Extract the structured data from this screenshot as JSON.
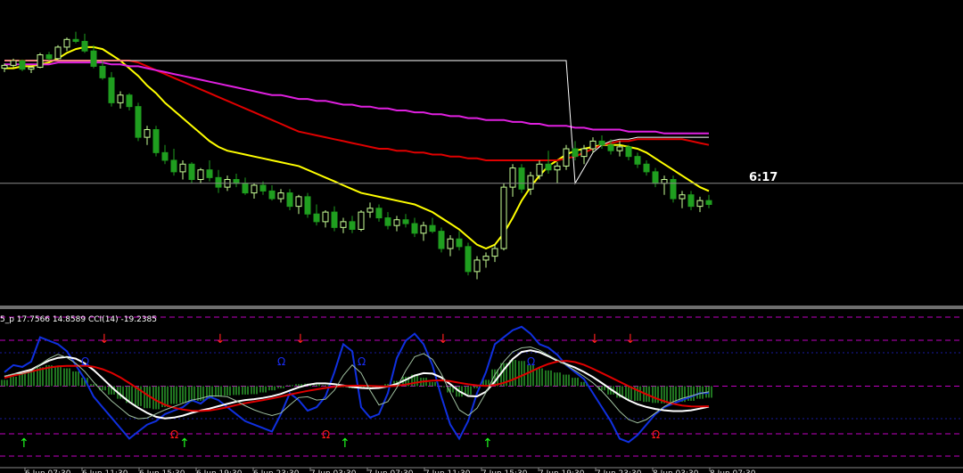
{
  "timer_label": "6:17",
  "indicator_label": "5_p 17.7566 14.8589  CCI(14) -19.2385",
  "time_axis_labels": [
    "6 Jun 07:30",
    "6 Jun 11:30",
    "6 Jun 15:30",
    "6 Jun 19:30",
    "6 Jun 23:30",
    "7 Jun 03:30",
    "7 Jun 07:30",
    "7 Jun 11:30",
    "7 Jun 15:30",
    "7 Jun 19:30",
    "7 Jun 23:30",
    "8 Jun 03:30",
    "8 Jun 07:30"
  ],
  "colors": {
    "background": "#000000",
    "bull_candle": "#c8ff96",
    "bear_candle": "#1f9e1f",
    "fast_ma": "#ffff00",
    "mid_ma": "#e00000",
    "slow_ma": "#e020e0",
    "white_line": "#ffffff",
    "cci_line": "#1030e0",
    "histogram": "#2a9a2a",
    "level_dashed": "#c000c0",
    "level_dotted": "#1a1aa0",
    "arrow_up": "#20ff20",
    "arrow_down": "#ff2020",
    "marker_blue": "#1a2cf0",
    "marker_red": "#ff1a1a"
  },
  "chart_data": [
    {
      "type": "candlestick",
      "title": "",
      "price_line_label": "6:17",
      "candles": [
        [
          100,
          102.5,
          98,
          101.5
        ],
        [
          101.5,
          105,
          100.5,
          104
        ],
        [
          104,
          104.5,
          98.5,
          99.5
        ],
        [
          99.5,
          101,
          97.5,
          100.5
        ],
        [
          100.5,
          108,
          100,
          107
        ],
        [
          107,
          108.5,
          104,
          105
        ],
        [
          105,
          112,
          104.5,
          111
        ],
        [
          111,
          116,
          109,
          115
        ],
        [
          115,
          119,
          113,
          114
        ],
        [
          114,
          118,
          108,
          109
        ],
        [
          109,
          112,
          100,
          101
        ],
        [
          101,
          104,
          94,
          95
        ],
        [
          95,
          98,
          80,
          82
        ],
        [
          82,
          88,
          79,
          86
        ],
        [
          86,
          87,
          78,
          80
        ],
        [
          80,
          82,
          62,
          64
        ],
        [
          64,
          70,
          60,
          68
        ],
        [
          68,
          70,
          54,
          56
        ],
        [
          56,
          60,
          50,
          52
        ],
        [
          52,
          58,
          44,
          46
        ],
        [
          46,
          52,
          42,
          50
        ],
        [
          50,
          51,
          40,
          42
        ],
        [
          42,
          48,
          40,
          47
        ],
        [
          47,
          52,
          41,
          43
        ],
        [
          43,
          47,
          35,
          38
        ],
        [
          38,
          44,
          36,
          42
        ],
        [
          42,
          45,
          38,
          40
        ],
        [
          40,
          43,
          34,
          35
        ],
        [
          35,
          40,
          32,
          39
        ],
        [
          39,
          41,
          34,
          36
        ],
        [
          36,
          39,
          31,
          32
        ],
        [
          32,
          37,
          30,
          35
        ],
        [
          35,
          37,
          26,
          28
        ],
        [
          28,
          34,
          24,
          33
        ],
        [
          33,
          35,
          22,
          24
        ],
        [
          24,
          29,
          18,
          20
        ],
        [
          20,
          26,
          17,
          25
        ],
        [
          25,
          28,
          15,
          17
        ],
        [
          17,
          22,
          14,
          20
        ],
        [
          20,
          23,
          14,
          16
        ],
        [
          16,
          26,
          15,
          25
        ],
        [
          25,
          30,
          22,
          27
        ],
        [
          27,
          29,
          20,
          22
        ],
        [
          22,
          25,
          16,
          18
        ],
        [
          18,
          23,
          15,
          21
        ],
        [
          21,
          24,
          17,
          19
        ],
        [
          19,
          22,
          12,
          14
        ],
        [
          14,
          20,
          10,
          18
        ],
        [
          18,
          22,
          14,
          15
        ],
        [
          15,
          17,
          4,
          6
        ],
        [
          6,
          13,
          2,
          11
        ],
        [
          11,
          15,
          5,
          7
        ],
        [
          7,
          9,
          -8,
          -6
        ],
        [
          -6,
          2,
          -10,
          0
        ],
        [
          0,
          4,
          -4,
          2
        ],
        [
          2,
          8,
          -1,
          6
        ],
        [
          6,
          40,
          5,
          38
        ],
        [
          38,
          50,
          33,
          48
        ],
        [
          48,
          50,
          35,
          37
        ],
        [
          37,
          46,
          34,
          44
        ],
        [
          44,
          52,
          42,
          50
        ],
        [
          50,
          57,
          45,
          47
        ],
        [
          47,
          51,
          40,
          49
        ],
        [
          49,
          60,
          47,
          58
        ],
        [
          58,
          62,
          52,
          54
        ],
        [
          54,
          60,
          50,
          58
        ],
        [
          58,
          64,
          56,
          62
        ],
        [
          62,
          65,
          58,
          60
        ],
        [
          60,
          63,
          55,
          57
        ],
        [
          57,
          62,
          54,
          59
        ],
        [
          59,
          60,
          52,
          54
        ],
        [
          54,
          56,
          48,
          50
        ],
        [
          50,
          52,
          44,
          46
        ],
        [
          46,
          48,
          38,
          40
        ],
        [
          40,
          44,
          34,
          42
        ],
        [
          42,
          44,
          30,
          32
        ],
        [
          32,
          36,
          27,
          34
        ],
        [
          34,
          36,
          26,
          28
        ],
        [
          28,
          33,
          25,
          31
        ],
        [
          31,
          34,
          27,
          29
        ]
      ],
      "overlays": [
        {
          "name": "",
          "color": "#ffff00",
          "values": [
            100,
            100,
            101,
            101,
            102,
            103,
            105,
            108,
            110,
            111,
            111,
            110,
            107,
            104,
            100,
            96,
            91,
            87,
            82,
            78,
            74,
            70,
            66,
            62,
            59,
            57,
            56,
            55,
            54,
            53,
            52,
            51,
            50,
            49,
            47,
            45,
            43,
            41,
            39,
            37,
            35,
            34,
            33,
            32,
            31,
            30,
            29,
            27,
            25,
            22,
            19,
            16,
            12,
            8,
            6,
            8,
            14,
            22,
            31,
            38,
            44,
            49,
            52,
            55,
            57,
            58,
            59,
            60,
            60,
            60,
            59,
            58,
            56,
            53,
            50,
            47,
            44,
            41,
            38,
            36
          ]
        },
        {
          "name": "",
          "color": "#e00000",
          "values": [
            104,
            104,
            104,
            104,
            104,
            104,
            104,
            104,
            104,
            104,
            104,
            104,
            104,
            104,
            104,
            103,
            101,
            99,
            97,
            95,
            93,
            91,
            89,
            87,
            85,
            83,
            81,
            79,
            77,
            75,
            73,
            71,
            69,
            67,
            66,
            65,
            64,
            63,
            62,
            61,
            60,
            59,
            58,
            58,
            57,
            57,
            56,
            56,
            55,
            55,
            54,
            54,
            53,
            53,
            52,
            52,
            52,
            52,
            52,
            52,
            52,
            52,
            52,
            53,
            54,
            56,
            58,
            60,
            61,
            62,
            62,
            63,
            63,
            63,
            63,
            63,
            63,
            62,
            61,
            60
          ]
        },
        {
          "name": "",
          "color": "#e020e0",
          "values": [
            102,
            102,
            102,
            102,
            102,
            102,
            103,
            103,
            103,
            103,
            103,
            103,
            102,
            102,
            101,
            101,
            100,
            99,
            98,
            97,
            96,
            95,
            94,
            93,
            92,
            91,
            90,
            89,
            88,
            87,
            86,
            86,
            85,
            84,
            84,
            83,
            83,
            82,
            81,
            81,
            80,
            80,
            79,
            79,
            78,
            78,
            77,
            77,
            76,
            76,
            75,
            75,
            74,
            74,
            73,
            73,
            73,
            72,
            72,
            71,
            71,
            70,
            70,
            70,
            69,
            69,
            68,
            68,
            68,
            68,
            67,
            67,
            67,
            67,
            66,
            66,
            66,
            66,
            66,
            66
          ]
        },
        {
          "name": "",
          "color": "#ffffff",
          "values": [
            104,
            104,
            104,
            104,
            104,
            104,
            104,
            104,
            104,
            104,
            104,
            104,
            104,
            104,
            104,
            104,
            104,
            104,
            104,
            104,
            104,
            104,
            104,
            104,
            104,
            104,
            104,
            104,
            104,
            104,
            104,
            104,
            104,
            104,
            104,
            104,
            104,
            104,
            104,
            104,
            104,
            104,
            104,
            104,
            104,
            104,
            104,
            104,
            104,
            104,
            104,
            104,
            104,
            104,
            104,
            104,
            104,
            104,
            104,
            104,
            104,
            104,
            104,
            104,
            40,
            48,
            56,
            60,
            62,
            63,
            63,
            64,
            64,
            64,
            64,
            64,
            64,
            64,
            64,
            64
          ]
        }
      ],
      "price_line": 40,
      "ylim": [
        -20,
        130
      ]
    },
    {
      "type": "oscillator",
      "title": "5_p 17.7566 14.8589  CCI(14) -19.2385",
      "histogram": [
        30,
        45,
        60,
        75,
        90,
        100,
        95,
        85,
        70,
        40,
        10,
        -20,
        -40,
        -60,
        -80,
        -95,
        -105,
        -110,
        -100,
        -85,
        -80,
        -75,
        -70,
        -60,
        -50,
        -45,
        -42,
        -40,
        -38,
        -30,
        -20,
        -10,
        5,
        10,
        12,
        8,
        5,
        0,
        -5,
        -10,
        -8,
        -5,
        0,
        10,
        25,
        45,
        55,
        40,
        20,
        -5,
        -30,
        -50,
        -40,
        -10,
        30,
        80,
        110,
        125,
        120,
        100,
        85,
        75,
        65,
        55,
        40,
        20,
        0,
        -20,
        -40,
        -55,
        -65,
        -70,
        -75,
        -80,
        -82,
        -80,
        -75,
        -70,
        -60,
        -55
      ],
      "cci": [
        40,
        60,
        55,
        70,
        140,
        130,
        120,
        100,
        60,
        20,
        -30,
        -60,
        -90,
        -120,
        -150,
        -130,
        -110,
        -100,
        -80,
        -70,
        -60,
        -40,
        -50,
        -30,
        -40,
        -60,
        -80,
        -100,
        -110,
        -120,
        -130,
        -80,
        -20,
        -40,
        -70,
        -60,
        -30,
        40,
        120,
        100,
        -60,
        -90,
        -80,
        -20,
        80,
        130,
        150,
        120,
        60,
        -30,
        -110,
        -150,
        -100,
        -20,
        40,
        120,
        140,
        160,
        170,
        150,
        120,
        110,
        90,
        60,
        40,
        20,
        -20,
        -60,
        -100,
        -150,
        -160,
        -140,
        -110,
        -80,
        -60,
        -50,
        -40,
        -30,
        -20,
        -19.2385
      ]
    }
  ]
}
